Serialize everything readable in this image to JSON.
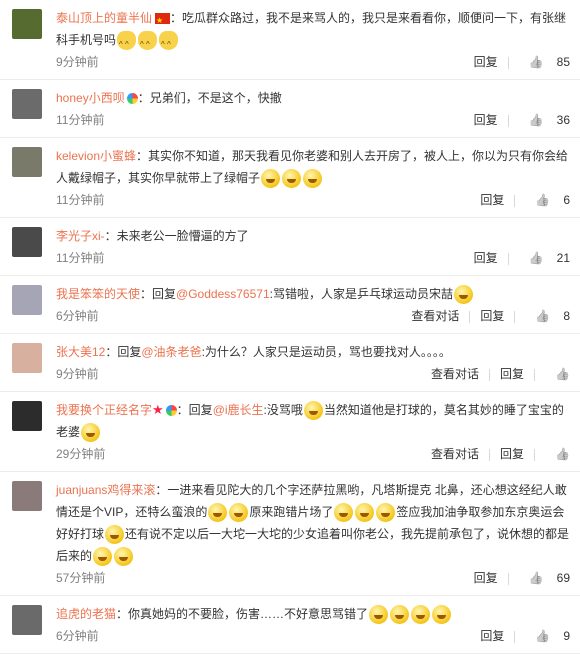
{
  "comments": [
    {
      "name": "泰山顶上的童半仙",
      "text": "：吃瓜群众路过，我不是来骂人的，我只是来看看你，顺便问一下，有张继科手机号吗",
      "time": "9分钟前",
      "reply": "回复",
      "likes": "85",
      "avatar_color": "#556b2f",
      "flag": true,
      "emoji_cat": 3
    },
    {
      "name": "honey小西呗",
      "text": "：兄弟们，不是这个，快撤",
      "time": "11分钟前",
      "reply": "回复",
      "likes": "36",
      "avatar_color": "#6b6b6b",
      "badge": true
    },
    {
      "name": "kelevion小蜜蜂",
      "text": "：其实你不知道，那天我看见你老婆和别人去开房了，被人上，你以为只有你会给人戴绿帽子，其实你早就带上了绿帽子",
      "time": "11分钟前",
      "reply": "回复",
      "likes": "6",
      "avatar_color": "#7a7a6a",
      "emoji_after": 3
    },
    {
      "name": "李光子xi-",
      "text": "：未来老公一脸懵逼的方了",
      "time": "11分钟前",
      "reply": "回复",
      "likes": "21",
      "avatar_color": "#4a4a4a"
    },
    {
      "name": "我是笨笨的天使",
      "prefix": "：回复",
      "mention": "@Goddess76571",
      "text": ":骂错啦，人家是乒乓球运动员宋喆",
      "time": "6分钟前",
      "extra": "查看对话",
      "reply": "回复",
      "likes": "8",
      "avatar_color": "#a5a5b5",
      "emoji_after": 1
    },
    {
      "name": "张大美12",
      "prefix": "：回复",
      "mention": "@油条老爸",
      "text": ":为什么？人家只是运动员，骂也要找对人。。。。",
      "time": "9分钟前",
      "extra": "查看对话",
      "reply": "回复",
      "likes": "",
      "avatar_color": "#d8b0a0"
    },
    {
      "name": "我要换个正经名字",
      "prefix": "：回复",
      "mention": "@i鹿长生",
      "text": ":没骂哦",
      "text2": "当然知道他是打球的，莫名其妙的睡了宝宝的老婆",
      "time": "29分钟前",
      "extra": "查看对话",
      "reply": "回复",
      "likes": "",
      "avatar_color": "#2c2c2c",
      "star": true,
      "badge": true,
      "emoji_after": 1
    },
    {
      "name": "juanjuans鸡得来滚",
      "text": "：一进来看见陀大的几个字还萨拉黑哟，凡塔斯提克 北鼻，还心想这经纪人敢情还是个VIP，还特么蛮浪的",
      "text2": "原来跑错片场了",
      "text3": "签应我加油争取参加东京奥运会好好打球",
      "text4": "还有说不定以后一大坨一大坨的少女追着叫你老公，我先提前承包了，说休想的都是后来的",
      "time": "57分钟前",
      "reply": "回复",
      "likes": "69",
      "avatar_color": "#8a7a7a"
    },
    {
      "name": "追虎的老猫",
      "text": "：你真她妈的不要脸，伤害……不好意思骂错了",
      "time": "6分钟前",
      "reply": "回复",
      "likes": "9",
      "avatar_color": "#6a6a6a",
      "emoji_after": 4
    }
  ],
  "labels": {
    "thumb_icon": "thumb-up-icon"
  }
}
